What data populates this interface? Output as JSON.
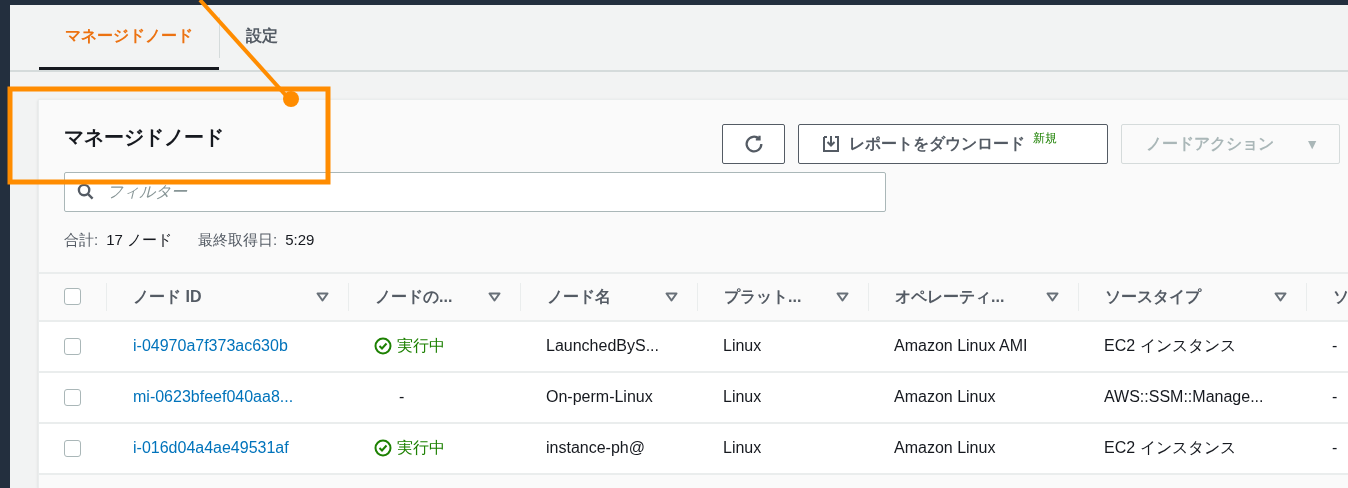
{
  "tabs": [
    {
      "label": "マネージドノード",
      "selected": true
    },
    {
      "label": "設定",
      "selected": false
    }
  ],
  "panel": {
    "title": "マネージドノード",
    "actions": [
      {
        "kind": "refresh",
        "disabled": false
      },
      {
        "kind": "download",
        "label": "レポートをダウンロード",
        "badge": "新規",
        "disabled": false
      },
      {
        "kind": "dropdown",
        "label": "ノードアクション",
        "caret": "▼",
        "disabled": true
      }
    ],
    "filter": {
      "placeholder": "フィルター"
    },
    "summary": [
      {
        "label": "合計:",
        "value": "17 ノード"
      },
      {
        "label": "最終取得日:",
        "value": "5:29"
      }
    ]
  },
  "table": {
    "select_all": {
      "checked": false
    },
    "columns": [
      {
        "label": "ノード ID",
        "sortable": true
      },
      {
        "label": "ノードの...",
        "sortable": true
      },
      {
        "label": "ノード名",
        "sortable": true
      },
      {
        "label": "プラット...",
        "sortable": true
      },
      {
        "label": "オペレーティ...",
        "sortable": true
      },
      {
        "label": "ソースタイプ",
        "sortable": true
      },
      {
        "label": "ソ"
      }
    ],
    "rows": [
      {
        "checked": false,
        "id": "i-04970a7f373ac630b",
        "status": {
          "kind": "running",
          "text": "実行中"
        },
        "name": "LaunchedByS...",
        "platform": "Linux",
        "os": "Amazon Linux AMI",
        "source": "EC2 インスタンス",
        "column_7": "-"
      },
      {
        "checked": false,
        "id": "mi-0623bfeef040aa8...",
        "status": {
          "kind": "none",
          "text": "-"
        },
        "name": "On-perm-Linux",
        "platform": "Linux",
        "os": "Amazon Linux",
        "source": "AWS::SSM::Manage...",
        "column_7": "-"
      },
      {
        "checked": false,
        "id": "i-016d04a4ae49531af",
        "status": {
          "kind": "running",
          "text": "実行中"
        },
        "name": "instance-ph@",
        "platform": "Linux",
        "os": "Amazon Linux",
        "source": "EC2 インスタンス",
        "column_7": "-"
      }
    ]
  },
  "callout": {
    "kind": "highlight"
  }
}
